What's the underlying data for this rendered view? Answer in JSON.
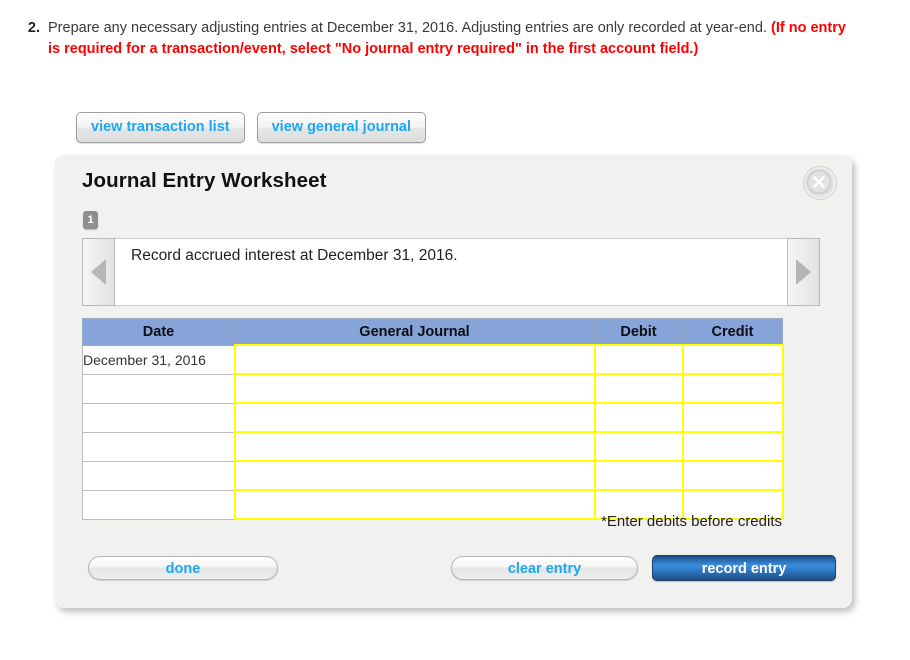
{
  "question": {
    "number": "2.",
    "text_part1": "Prepare any necessary adjusting entries at December 31, 2016. Adjusting entries are only recorded at year-end. ",
    "text_required": "(If no entry is required for a transaction/event, select \"No journal entry required\" in the first account field.)"
  },
  "view_buttons": [
    {
      "label": "view transaction list"
    },
    {
      "label": "view general journal"
    }
  ],
  "panel": {
    "title": "Journal Entry Worksheet",
    "close_icon": "close-icon",
    "entry_index": "1",
    "transaction_description": "Record accrued interest at December 31, 2016.",
    "prev_icon": "chevron-left-icon",
    "next_icon": "chevron-right-icon",
    "note": "*Enter debits before credits"
  },
  "table": {
    "headers": [
      "Date",
      "General Journal",
      "Debit",
      "Credit"
    ],
    "rows": [
      {
        "date": "December 31, 2016",
        "general_journal": "",
        "debit": "",
        "credit": ""
      },
      {
        "date": "",
        "general_journal": "",
        "debit": "",
        "credit": ""
      },
      {
        "date": "",
        "general_journal": "",
        "debit": "",
        "credit": ""
      },
      {
        "date": "",
        "general_journal": "",
        "debit": "",
        "credit": ""
      },
      {
        "date": "",
        "general_journal": "",
        "debit": "",
        "credit": ""
      },
      {
        "date": "",
        "general_journal": "",
        "debit": "",
        "credit": ""
      }
    ]
  },
  "footer_buttons": {
    "done": "done",
    "clear_entry": "clear entry",
    "record_entry": "record entry"
  },
  "colors": {
    "header_blue": "#86a4d8",
    "link_blue": "#1ca7f0",
    "record_blue": "#3a8ddd",
    "required_red": "#ff0000",
    "input_border_yellow": "#ffff00",
    "panel_bg": "#f1f1f0"
  }
}
